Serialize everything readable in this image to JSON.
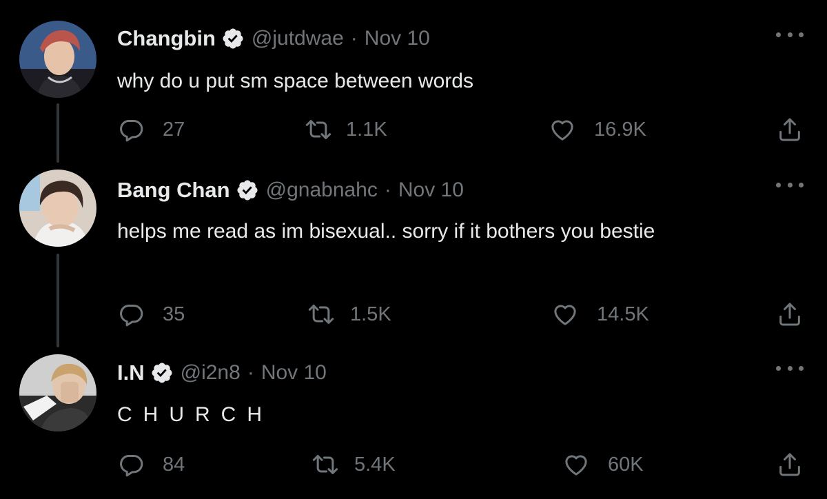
{
  "tweets": [
    {
      "name": "Changbin",
      "handle": "@jutdwae",
      "separator": "·",
      "date": "Nov 10",
      "text": "why do u put sm space between words",
      "replies": "27",
      "retweets": "1.1K",
      "likes": "16.9K"
    },
    {
      "name": "Bang Chan",
      "handle": "@gnabnahc",
      "separator": "·",
      "date": "Nov 10",
      "text": "helps   me   read   as   im   bisexual..   sorry   if   it   bothers   you bestie",
      "replies": "35",
      "retweets": "1.5K",
      "likes": "14.5K"
    },
    {
      "name": "I.N",
      "handle": "@i2n8",
      "separator": "·",
      "date": "Nov 10",
      "text": "CHURCH",
      "replies": "84",
      "retweets": "5.4K",
      "likes": "60K"
    }
  ],
  "icons": {
    "verified": "verified-badge-icon",
    "more": "more-horizontal-icon",
    "reply": "reply-bubble-icon",
    "retweet": "retweet-icon",
    "like": "heart-icon",
    "share": "share-icon"
  },
  "colors": {
    "background": "#000000",
    "text": "#e7e9ea",
    "secondary": "#71767b",
    "thread_line": "#333639"
  }
}
